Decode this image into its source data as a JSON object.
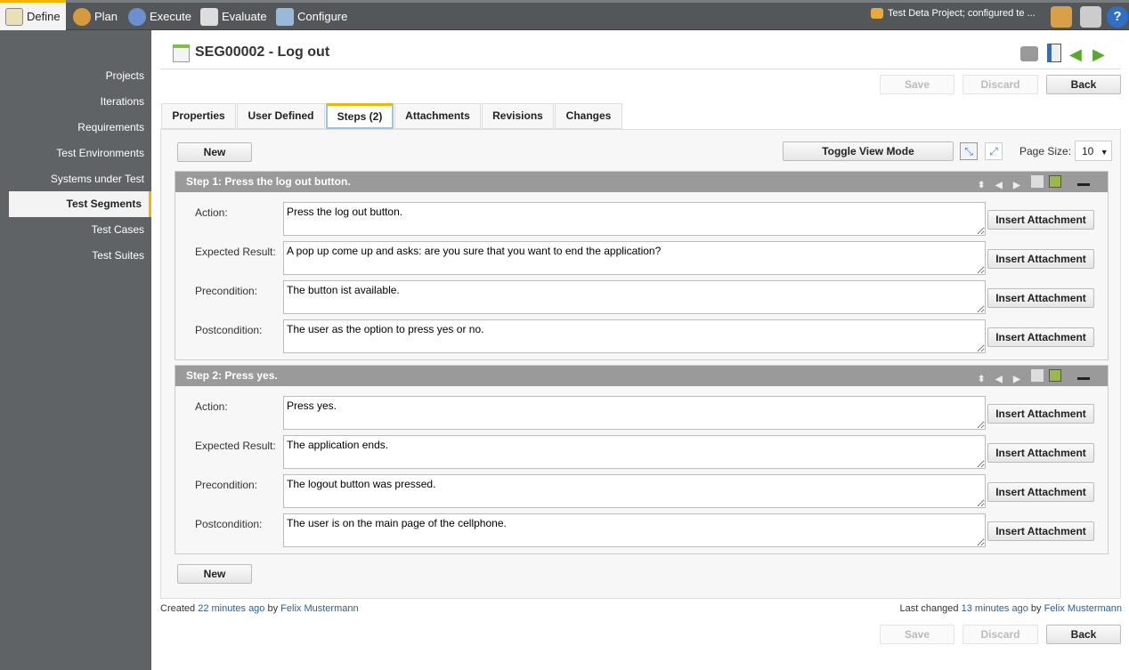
{
  "topnav": {
    "items": [
      {
        "label": "Define",
        "icon": "notepad-pencil-icon"
      },
      {
        "label": "Plan",
        "icon": "people-icon"
      },
      {
        "label": "Execute",
        "icon": "gear-icon"
      },
      {
        "label": "Evaluate",
        "icon": "report-chart-icon"
      },
      {
        "label": "Configure",
        "icon": "tools-icon"
      }
    ],
    "project": "Test Deta Project; configured te ..."
  },
  "sidebar": {
    "items": [
      "Projects",
      "Iterations",
      "Requirements",
      "Test Environments",
      "Systems under Test",
      "Test Segments",
      "Test Cases",
      "Test Suites"
    ],
    "active": "Test Segments"
  },
  "page": {
    "title": "SEG00002 - Log out"
  },
  "buttons": {
    "save": "Save",
    "discard": "Discard",
    "back": "Back",
    "new": "New",
    "toggle": "Toggle View Mode",
    "insert": "Insert Attachment"
  },
  "tabs": [
    "Properties",
    "User Defined",
    "Steps (2)",
    "Attachments",
    "Revisions",
    "Changes"
  ],
  "page_size": {
    "label": "Page Size:",
    "value": "10"
  },
  "labels": {
    "action": "Action:",
    "expected": "Expected Result:",
    "pre": "Precondition:",
    "post": "Postcondition:"
  },
  "steps": [
    {
      "title": "Step 1: Press the log out button.",
      "action": "Press the log out button.",
      "expected": "A pop up come up and asks: are you sure that you want to end the application?",
      "pre": "The button ist available.",
      "post": "The user as the option to press yes or no."
    },
    {
      "title": "Step 2: Press yes.",
      "action": "Press yes.",
      "expected": "The application ends.",
      "pre": "The logout button was pressed.",
      "post": "The user is on the main page of the cellphone."
    }
  ],
  "footer": {
    "created_prefix": "Created",
    "created_time": "22 minutes ago",
    "by": "by",
    "created_user": "Felix Mustermann",
    "changed_prefix": "Last changed",
    "changed_time": "13 minutes ago",
    "changed_user": "Felix Mustermann"
  },
  "colors": {
    "accent": "#f5b400",
    "topbar": "#54575a",
    "sidebar": "#5f6366",
    "step_header": "#9a9a9a",
    "link": "#2a5ca8"
  }
}
